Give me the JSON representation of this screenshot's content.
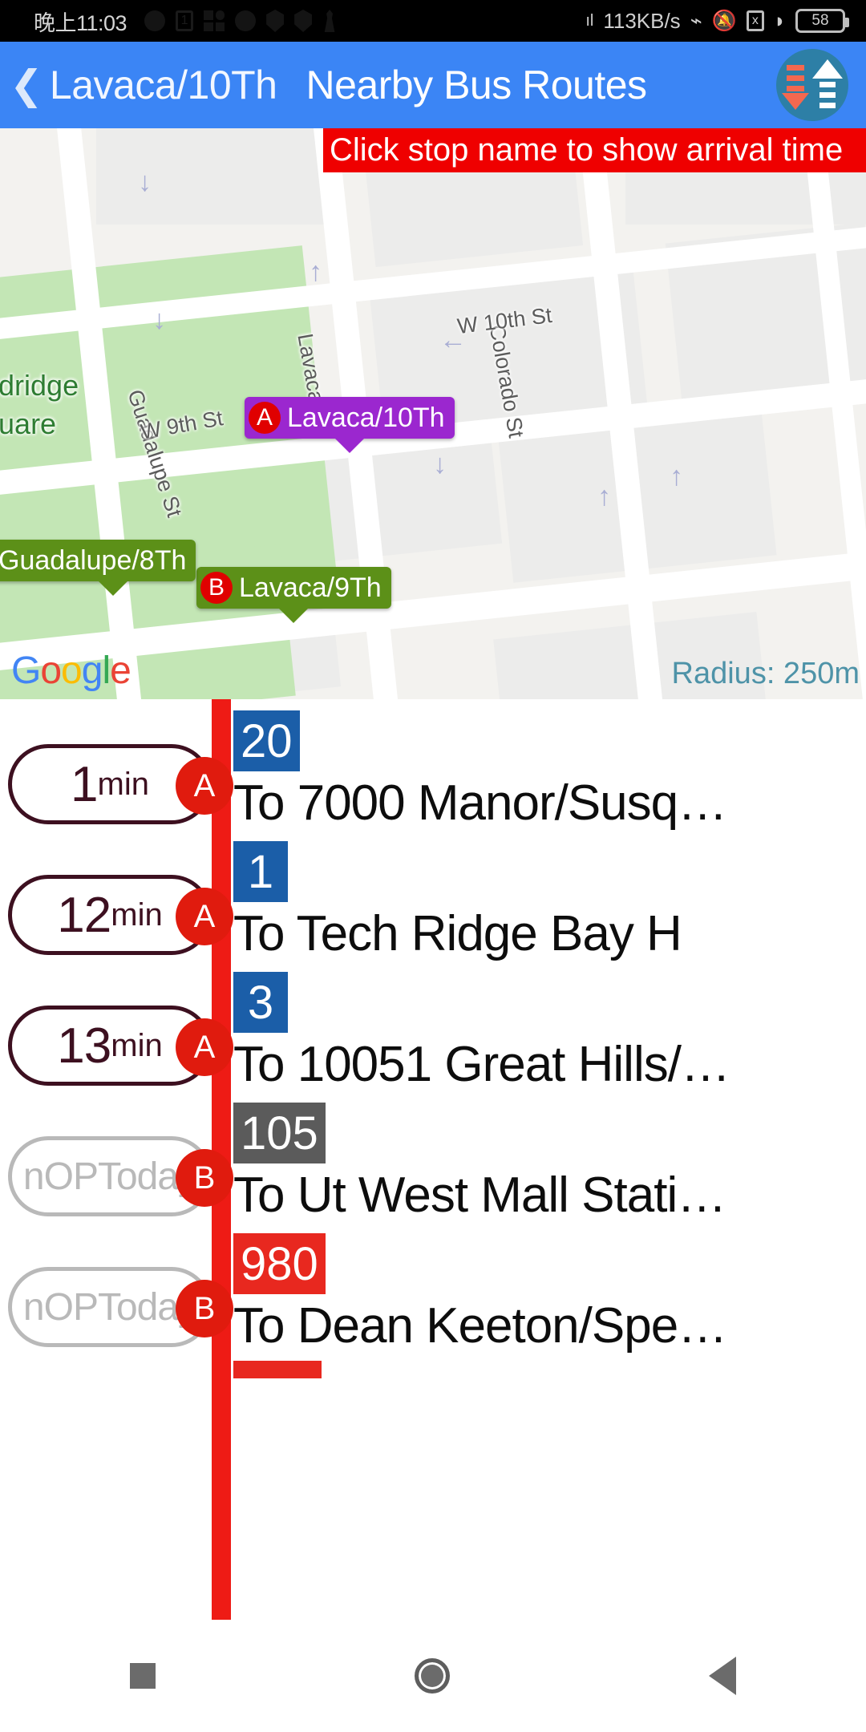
{
  "status_bar": {
    "time": "晚上11:03",
    "network_speed": "113KB/s",
    "battery": "58",
    "icons": [
      "dot-icon",
      "sim-card-icon",
      "apps-grid-icon",
      "info-circle-icon",
      "shield-icon",
      "shield-icon",
      "person-icon",
      "signal-bars-icon",
      "bluetooth-icon",
      "mute-bell-icon",
      "x-box-icon",
      "wifi-icon",
      "battery-icon"
    ]
  },
  "app_bar": {
    "back_icon": "chevron-left-icon",
    "stop_name": "Lavaca/10Th",
    "title": "Nearby Bus Routes",
    "action_icon": "upload-download-arrows-icon"
  },
  "map": {
    "banner_text": "Click stop name to show arrival time",
    "radius_label": "Radius: 250m",
    "attribution": "Google",
    "street_labels": [
      "Guadalupe St",
      "Lavaca St",
      "Colorado St",
      "W 10th St",
      "W 9th St",
      "St"
    ],
    "park_label_line1": "oldridge",
    "park_label_line2": "quare",
    "pins": [
      {
        "letter": "A",
        "label": "Lavaca/10Th",
        "color": "#9b27cf"
      },
      {
        "letter": "B",
        "label": "Lavaca/9Th",
        "color": "#5c9018"
      },
      {
        "letter": "",
        "label": "Guadalupe/8Th",
        "color": "#5c9018"
      }
    ]
  },
  "routes": [
    {
      "eta_value": "1",
      "eta_unit": "min",
      "no_service": false,
      "stop": "A",
      "route": "20",
      "route_color": "#1b5ea8",
      "destination": "To 7000 Manor/Susq…"
    },
    {
      "eta_value": "12",
      "eta_unit": "min",
      "no_service": false,
      "stop": "A",
      "route": "1",
      "route_color": "#1b5ea8",
      "destination": "To Tech Ridge Bay H"
    },
    {
      "eta_value": "13",
      "eta_unit": "min",
      "no_service": false,
      "stop": "A",
      "route": "3",
      "route_color": "#1b5ea8",
      "destination": "To 10051 Great Hills/…"
    },
    {
      "eta_value": "nOPToday",
      "eta_unit": "",
      "no_service": true,
      "stop": "B",
      "route": "105",
      "route_color": "#5b5b5b",
      "destination": "To Ut West Mall Stati…"
    },
    {
      "eta_value": "nOPToday",
      "eta_unit": "",
      "no_service": true,
      "stop": "B",
      "route": "980",
      "route_color": "#e8281f",
      "destination": "To Dean Keeton/Spe…"
    }
  ],
  "nav_bar": {
    "recents_icon": "square-icon",
    "home_icon": "circle-icon",
    "back_icon": "triangle-left-icon"
  }
}
